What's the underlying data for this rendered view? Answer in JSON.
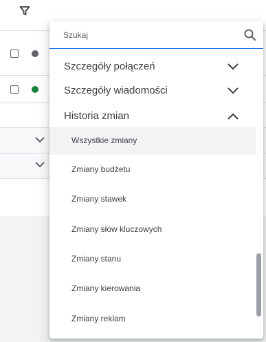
{
  "background": {
    "filter_icon": "filter-icon",
    "rows": [
      {
        "checked": false,
        "status_color": "#5f6368"
      },
      {
        "checked": false,
        "status_color": "#188038"
      }
    ],
    "expand_icons": [
      "chevron-down-icon",
      "chevron-down-icon"
    ]
  },
  "dropdown": {
    "search": {
      "placeholder": "Szukaj",
      "value": "",
      "icon": "search-icon"
    },
    "sections": [
      {
        "label": "Szczegóły połączeń",
        "expanded": false
      },
      {
        "label": "Szczegóły wiadomości",
        "expanded": false
      },
      {
        "label": "Historia zmian",
        "expanded": true
      }
    ],
    "items": [
      {
        "label": "Wszystkie zmiany",
        "highlighted": true
      },
      {
        "label": "Zmiany budżetu",
        "highlighted": false
      },
      {
        "label": "Zmiany stawek",
        "highlighted": false
      },
      {
        "label": "Zmiany słów kluczowych",
        "highlighted": false
      },
      {
        "label": "Zmiany stanu",
        "highlighted": false
      },
      {
        "label": "Zmiany kierowania",
        "highlighted": false
      },
      {
        "label": "Zmiany reklam",
        "highlighted": false
      }
    ]
  },
  "colors": {
    "accent": "#1a73e8",
    "text": "#3c4043",
    "status_gray": "#5f6368",
    "status_green": "#188038",
    "highlight": "#f1f3f4"
  }
}
